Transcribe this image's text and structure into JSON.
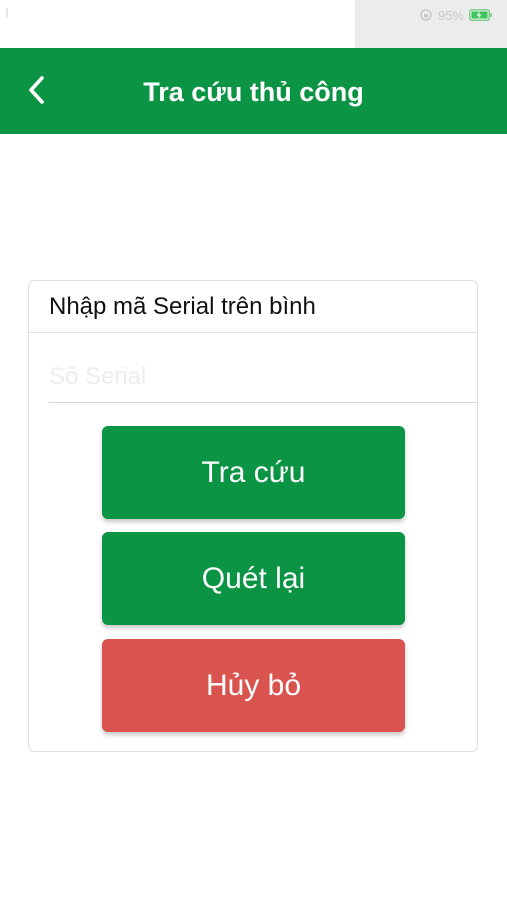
{
  "status_bar": {
    "battery_text": "95%"
  },
  "header": {
    "title": "Tra cứu thủ công",
    "back_icon": "chevron-left-icon"
  },
  "form": {
    "label": "Nhập mã Serial trên bình",
    "serial": {
      "value": "",
      "placeholder": "Số Serial"
    }
  },
  "buttons": {
    "lookup": "Tra cứu",
    "rescan": "Quét lại",
    "cancel": "Hủy bỏ"
  },
  "colors": {
    "primary": "#0a9444",
    "danger": "#d9534f"
  }
}
